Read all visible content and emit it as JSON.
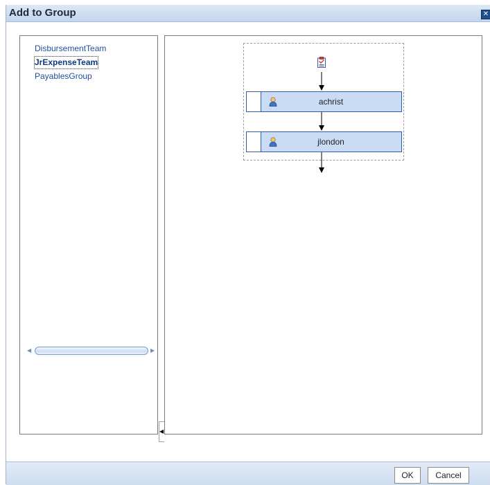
{
  "dialog": {
    "title": "Add to Group",
    "close_icon": "close-icon"
  },
  "groups": {
    "items": [
      {
        "label": "DisbursementTeam",
        "selected": false
      },
      {
        "label": "JrExpenseTeam",
        "selected": true
      },
      {
        "label": "PayablesGroup",
        "selected": false
      }
    ]
  },
  "flow": {
    "start_icon": "approval-task-icon",
    "participants": [
      {
        "label": "achrist",
        "icon": "user-icon"
      },
      {
        "label": "jlondon",
        "icon": "user-icon"
      }
    ]
  },
  "buttons": {
    "ok": "OK",
    "cancel": "Cancel"
  },
  "colors": {
    "node_fill": "#c9dcf3",
    "node_border": "#2e5aa8",
    "link": "#1f4f9a",
    "titlebar": "#c4d5ec"
  }
}
